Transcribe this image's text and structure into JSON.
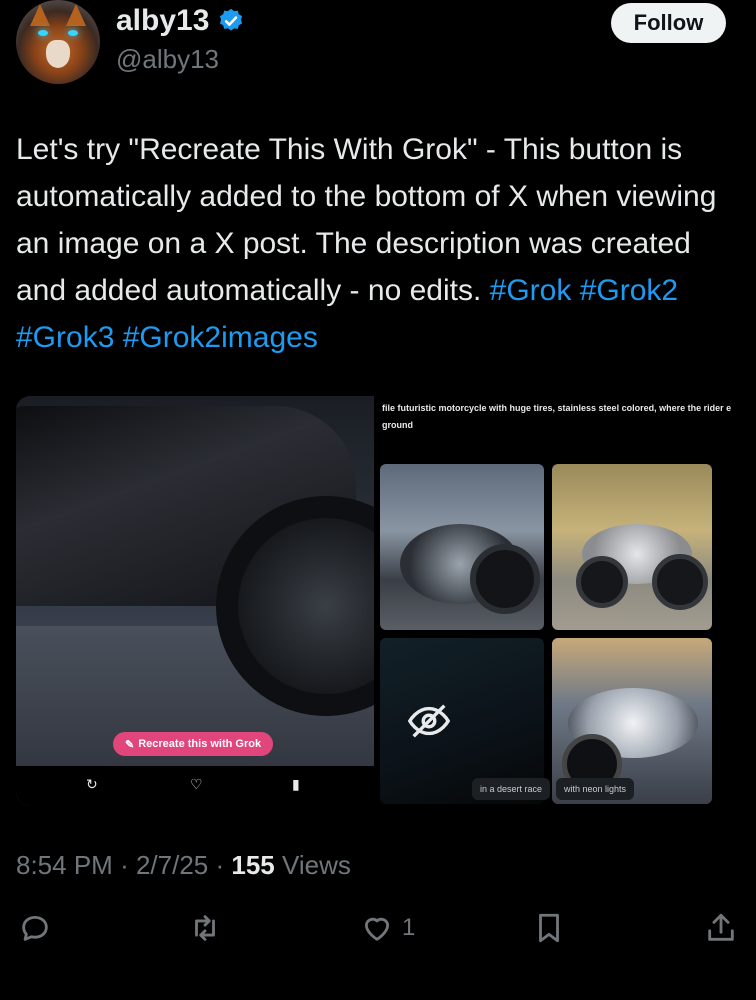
{
  "author": {
    "name": "alby13",
    "handle": "@alby13",
    "verified": true
  },
  "follow_button": {
    "label": "Follow"
  },
  "tweet": {
    "text_plain": "Let's try \"Recreate This With Grok\" - This button is automatically added to the bottom of X when viewing an image on a X post. The description was created and added automatically - no edits.",
    "hashtags": [
      "#Grok",
      "#Grok2",
      "#Grok3",
      "#Grok2images"
    ]
  },
  "media": {
    "recreate_button_label": "Recreate this with Grok",
    "prompt_text": "file futuristic motorcycle with huge tires, stainless steel colored, where the rider e ground",
    "tile_labels": [
      "in a desert race",
      "with neon lights"
    ]
  },
  "meta": {
    "time": "8:54 PM",
    "date": "2/7/25",
    "views_count": "155",
    "views_label": "Views"
  },
  "actions": {
    "reply_icon": "reply-icon",
    "repost_icon": "repost-icon",
    "like_icon": "heart-icon",
    "like_count": "1",
    "bookmark_icon": "bookmark-icon",
    "share_icon": "share-icon"
  },
  "colors": {
    "background": "#000000",
    "link": "#1d9bf0",
    "secondary_text": "#71767b",
    "verified": "#1d9bf0",
    "recreate_pill": "#e0457b"
  }
}
